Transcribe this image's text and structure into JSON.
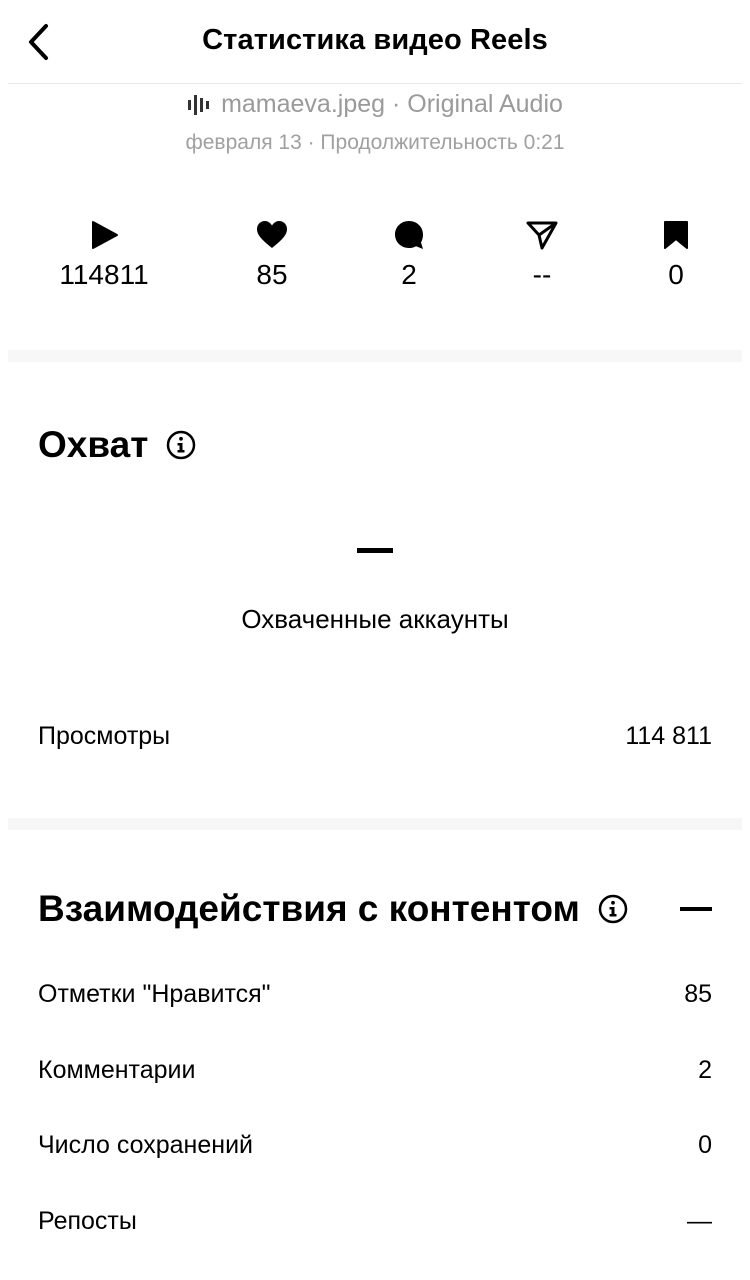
{
  "header": {
    "title": "Статистика видео Reels"
  },
  "audio": {
    "text": "mamaeva.jpeg · Original Audio"
  },
  "meta": {
    "text": "февраля 13 · Продолжительность 0:21"
  },
  "stats": [
    {
      "icon": "play-icon",
      "value": "114811"
    },
    {
      "icon": "heart-icon",
      "value": "85"
    },
    {
      "icon": "comment-icon",
      "value": "2"
    },
    {
      "icon": "share-icon",
      "value": "--"
    },
    {
      "icon": "bookmark-icon",
      "value": "0"
    }
  ],
  "reach": {
    "title": "Охват",
    "value": "—",
    "label": "Охваченные аккаунты",
    "views_label": "Просмотры",
    "views_value": "114 811"
  },
  "engagement": {
    "title": "Взаимодействия с контентом",
    "value": "—",
    "rows": [
      {
        "label": "Отметки \"Нравится\"",
        "value": "85"
      },
      {
        "label": "Комментарии",
        "value": "2"
      },
      {
        "label": "Число сохранений",
        "value": "0"
      },
      {
        "label": "Репосты",
        "value": "—"
      }
    ]
  }
}
